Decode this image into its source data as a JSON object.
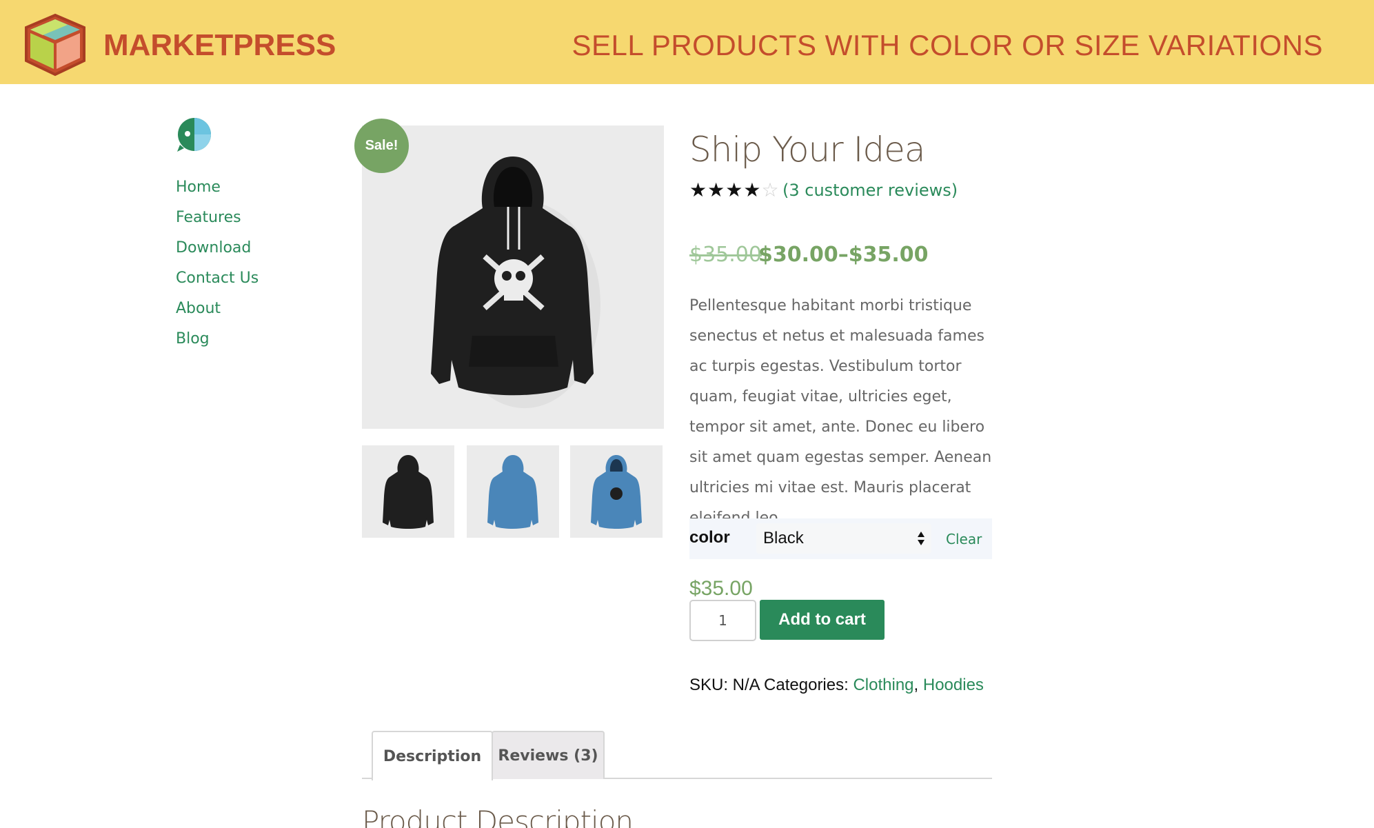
{
  "header": {
    "brand_name": "MARKETPRESS",
    "tagline": "SELL PRODUCTS WITH COLOR OR SIZE VARIATIONS",
    "background_color": "#f6d870",
    "text_color": "#c44d2c"
  },
  "sidebar": {
    "icon": "site-logo-icon",
    "items": [
      {
        "label": "Home"
      },
      {
        "label": "Features"
      },
      {
        "label": "Download"
      },
      {
        "label": "Contact Us"
      },
      {
        "label": "About"
      },
      {
        "label": "Blog"
      }
    ]
  },
  "gallery": {
    "sale_badge": "Sale!",
    "main_image": "black-skull-hoodie-image",
    "thumbnails": [
      {
        "name": "black-hoodie-back-thumbnail"
      },
      {
        "name": "blue-hoodie-back-thumbnail"
      },
      {
        "name": "blue-hoodie-front-thumbnail"
      }
    ]
  },
  "product": {
    "title": "Ship Your Idea",
    "rating": 4,
    "rating_max": 5,
    "reviews_link": "(3 customer reviews)",
    "price_old": "$35.00",
    "price_range": "$30.00–$35.00",
    "description": "Pellentesque habitant morbi tristique senectus et netus et malesuada fames ac turpis egestas. Vestibulum tortor quam, feugiat vitae, ultricies eget, tempor sit amet, ante. Donec eu libero sit amet quam egestas semper. Aenean ultricies mi vitae est. Mauris placerat eleifend leo.",
    "variation": {
      "label": "color",
      "selected": "Black",
      "clear_label": "Clear"
    },
    "variant_price": "$35.00",
    "quantity": "1",
    "add_to_cart_label": "Add to cart",
    "meta": {
      "sku": "SKU: N/A",
      "categories_label": "Categories:",
      "categories": [
        "Clothing",
        "Hoodies"
      ]
    }
  },
  "tabs": [
    {
      "label": "Description"
    },
    {
      "label": "Reviews (3)"
    }
  ],
  "section_heading": "Product Description",
  "colors": {
    "accent_green": "#2a8a5a",
    "price_green": "#77a464",
    "sale_badge": "#77a464"
  }
}
